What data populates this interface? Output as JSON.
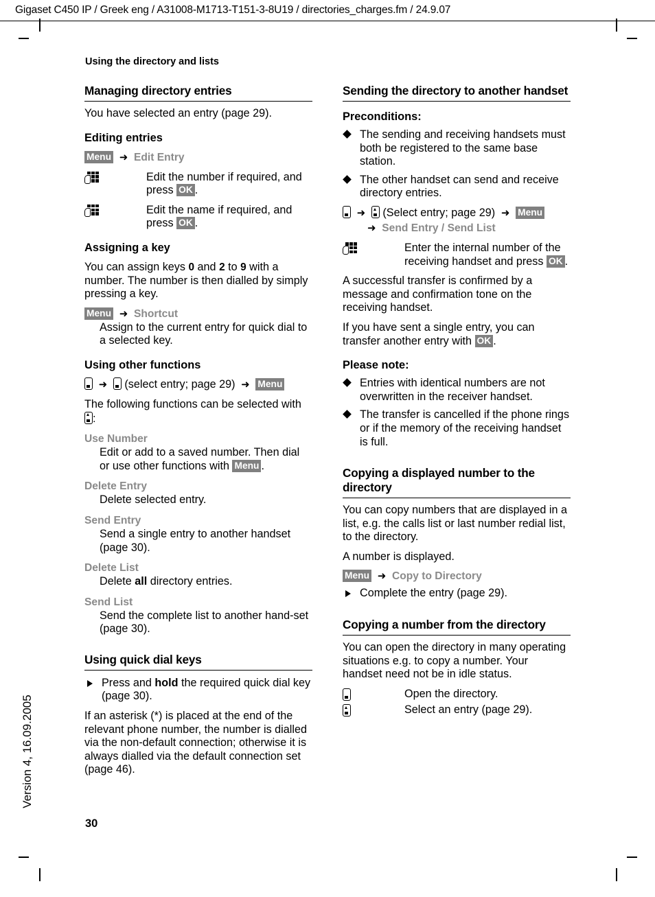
{
  "running_head": "Gigaset C450 IP / Greek eng / A31008-M1713-T151-3-8U19 / directories_charges.fm / 24.9.07",
  "section_label": "Using the directory and lists",
  "page_number": "30",
  "vertical_version": "Version 4, 16.09.2005",
  "softkeys": {
    "menu": "Menu",
    "ok": "OK"
  },
  "colors": {
    "badge_bg": "#808080",
    "badge_text": "#ffffff",
    "menu_item": "#8a8a8a",
    "text": "#000000"
  },
  "left_column": {
    "heading_managing": "Managing directory entries",
    "intro": "You have selected an entry (page 29).",
    "editing": {
      "heading": "Editing entries",
      "path_item": "Edit Entry",
      "step1_a": "Edit the number if required, and press ",
      "step1_b": ".",
      "step2_a": "Edit the name if required, and press ",
      "step2_b": "."
    },
    "assigning": {
      "heading": "Assigning a key",
      "body_a": "You can assign keys ",
      "key_0": "0",
      "body_b": " and ",
      "key_2": "2",
      "body_c": " to ",
      "key_9": "9",
      "body_d": " with a number. The number is then dialled by simply pressing a key.",
      "path_item": "Shortcut",
      "desc": "Assign to the current entry for quick dial to a selected key."
    },
    "other_functions": {
      "heading": "Using other functions",
      "path_mid": "(select entry; page 29)",
      "intro_a": "The following functions can be selected with ",
      "intro_b": ":",
      "items": [
        {
          "label": "Use Number",
          "desc_a": "Edit or add to a saved number. Then dial or use other functions with ",
          "desc_b": "."
        },
        {
          "label": "Delete Entry",
          "desc_a": "Delete selected entry.",
          "desc_b": ""
        },
        {
          "label": "Send Entry",
          "desc_a": "Send a single entry to another handset (page 30).",
          "desc_b": ""
        },
        {
          "label": "Delete List",
          "desc_a": "Delete ",
          "desc_bold": "all",
          "desc_b": " directory entries."
        },
        {
          "label": "Send List",
          "desc_a": "Send the complete list to another hand-set (page 30).",
          "desc_b": ""
        }
      ]
    },
    "quick_dial": {
      "heading": "Using quick dial keys",
      "bullet_a": "Press and ",
      "bullet_bold": "hold",
      "bullet_b": " the required quick dial key (page 30).",
      "body": "If an asterisk (*) is placed at the end of the relevant phone number, the number is dialled via the non-default connection; otherwise it is always dialled via the default connection set (page 46)."
    }
  },
  "right_column": {
    "heading_sending": "Sending the directory to another handset",
    "preconditions": {
      "heading": "Preconditions:",
      "items": [
        "The sending and receiving handsets must both be registered to the same base station.",
        "The other handset can send and receive directory entries."
      ],
      "path_mid": "(Select entry; page 29)",
      "path_item": "Send Entry / Send List",
      "step_a": "Enter the internal number of the receiving handset and press ",
      "step_b": "."
    },
    "transfer_body_1": "A successful transfer is confirmed by a message and confirmation tone on the receiving handset.",
    "transfer_body_2a": "If you have sent a single entry, you can transfer another entry with ",
    "transfer_body_2b": ".",
    "please_note": {
      "heading": "Please note:",
      "items": [
        "Entries with identical numbers are not overwritten in the receiver handset.",
        "The transfer is cancelled if the phone rings or if the memory of the receiving handset is full."
      ]
    },
    "copying_to": {
      "heading": "Copying a displayed number to the directory",
      "body": "You can copy numbers that are displayed in a list, e.g. the calls list or last number redial list, to the directory.",
      "body2": "A number is displayed.",
      "path_item": "Copy to Directory",
      "bullet": "Complete the entry (page 29)."
    },
    "copying_from": {
      "heading": "Copying a number from the directory",
      "body": "You can open the directory in many operating situations e.g. to copy a number. Your handset need not be in idle status.",
      "step1": "Open the directory.",
      "step2": "Select an entry (page 29)."
    }
  }
}
